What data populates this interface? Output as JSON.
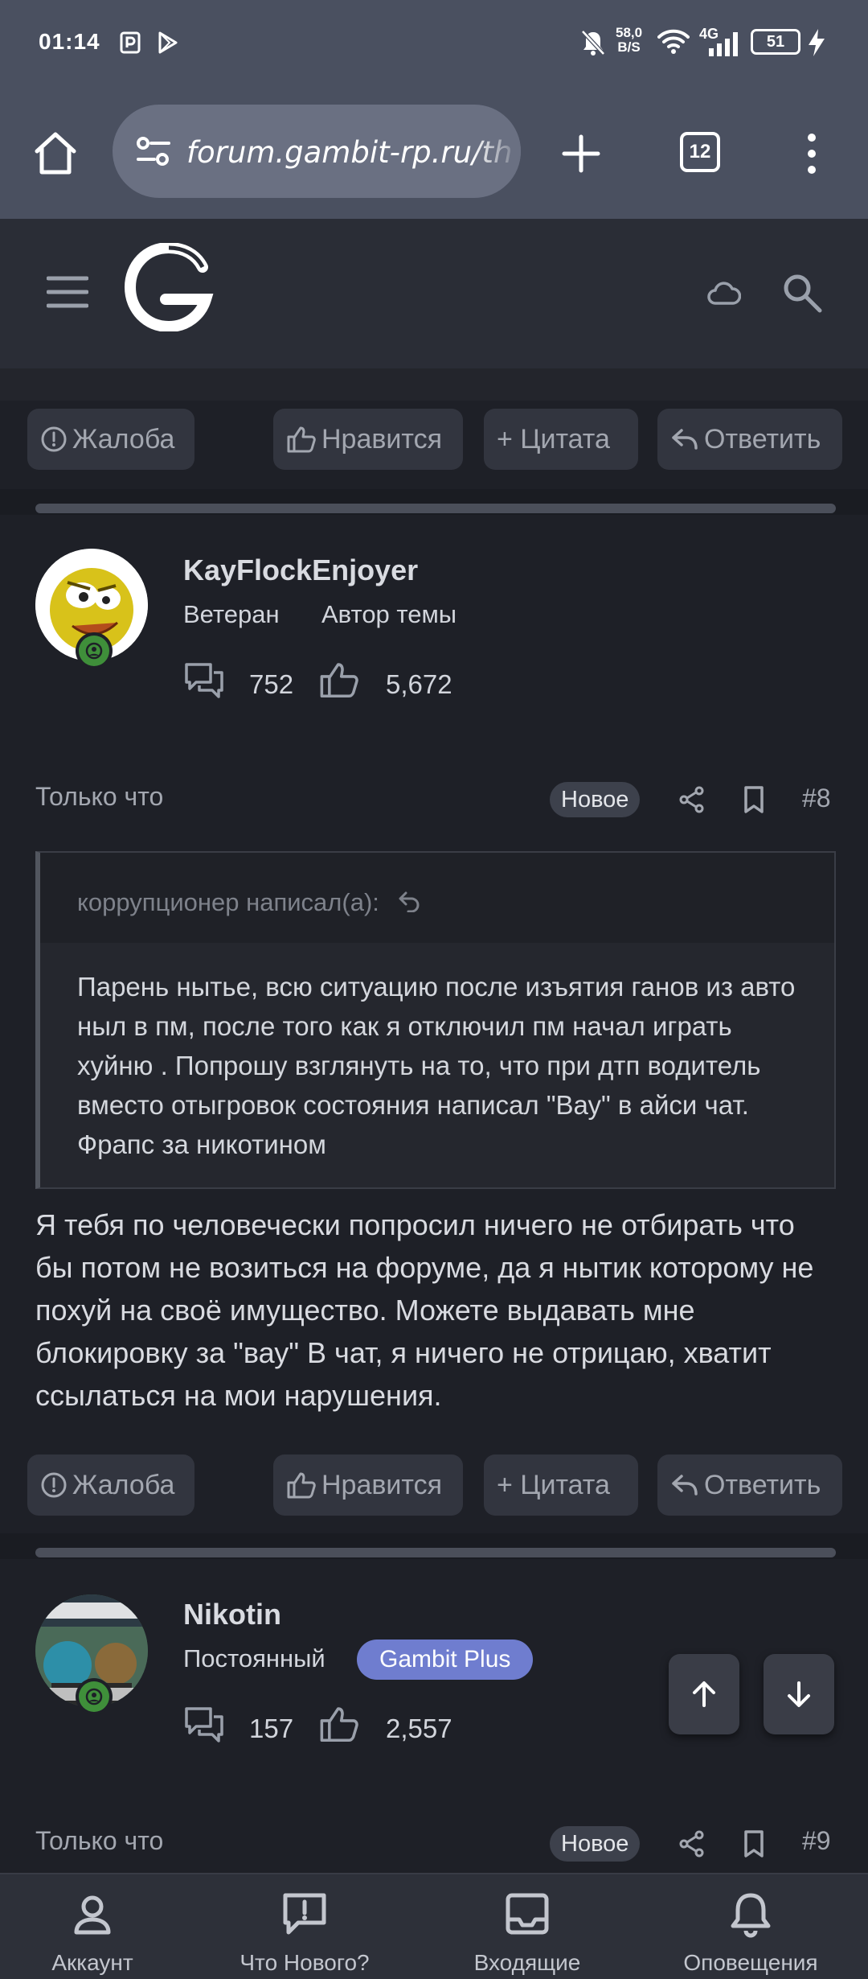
{
  "status_bar": {
    "time": "01:14",
    "net_speed_value": "58,0",
    "net_speed_unit": "B/S",
    "network_type": "4G",
    "battery": "51"
  },
  "browser": {
    "url": "forum.gambit-rp.ru/th",
    "tab_count": "12"
  },
  "post_actions": {
    "report": "Жалоба",
    "like": "Нравится",
    "quote": "+ Цитата",
    "reply": "Ответить"
  },
  "posts": [
    {
      "username": "KayFlockEnjoyer",
      "rank": "Ветеран",
      "author_badge": "Автор темы",
      "messages": "752",
      "likes": "5,672",
      "time": "Только что",
      "new_label": "Новое",
      "number": "#8",
      "quote": {
        "author": "коррупционер написал(а):",
        "text": "Парень нытье, всю ситуацию после изъятия ганов из авто ныл в пм, после того как я отключил пм начал играть хуйню . Попрошу взглянуть на то, что при дтп водитель вместо отыгровок состояния написал \"Вау\" в айси чат. Фрапс за никотином"
      },
      "text": "Я тебя по человечески попросил ничего не отбирать что бы потом не возиться на форуме, да я нытик которому не похуй на своё имущество. Можете выдавать мне блокировку за \"вау\" В чат, я ничего не отрицаю, хватит ссылаться на мои нарушения."
    },
    {
      "username": "Nikotin",
      "rank": "Постоянный",
      "group_badge": "Gambit Plus",
      "messages": "157",
      "likes": "2,557",
      "time": "Только что",
      "new_label": "Новое",
      "number": "#9"
    }
  ],
  "bottom_nav": {
    "account": "Аккаунт",
    "whats_new": "Что Нового?",
    "inbox": "Входящие",
    "alerts": "Оповещения"
  },
  "colors": {
    "background": "#1e2027",
    "header": "#2a2d36",
    "browser_bar": "#4a5060",
    "button": "#32353f",
    "badge_gambit_plus": "#6f7dcf",
    "online": "#3f8f3a"
  }
}
